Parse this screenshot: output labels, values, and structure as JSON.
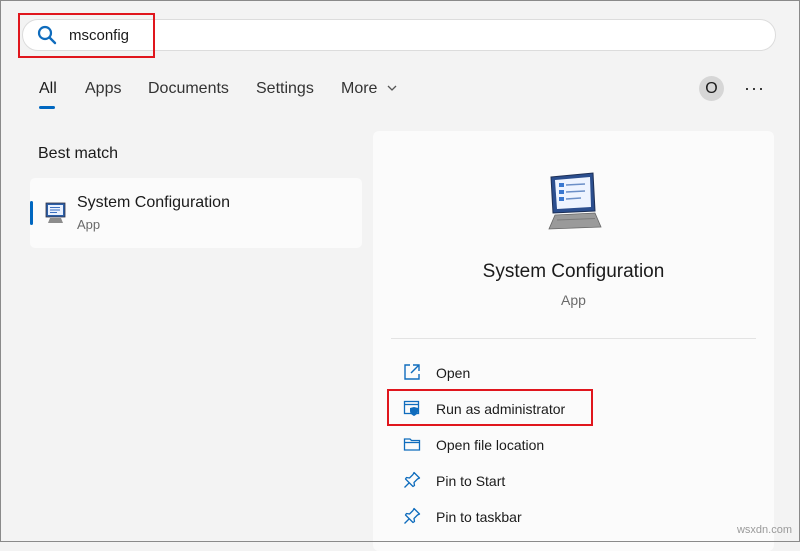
{
  "search": {
    "value": "msconfig",
    "placeholder": ""
  },
  "tabs": [
    {
      "label": "All",
      "active": true
    },
    {
      "label": "Apps"
    },
    {
      "label": "Documents"
    },
    {
      "label": "Settings"
    },
    {
      "label": "More"
    }
  ],
  "header": {
    "avatar_initial": "O",
    "more_options": "···"
  },
  "best_match": {
    "heading": "Best match",
    "title": "System Configuration",
    "subtitle": "App",
    "icon": "system-configuration-icon"
  },
  "detail": {
    "title": "System Configuration",
    "subtitle": "App",
    "icon": "system-configuration-icon",
    "actions": [
      {
        "label": "Open",
        "icon": "open-external-icon"
      },
      {
        "label": "Run as administrator",
        "icon": "shield-admin-icon"
      },
      {
        "label": "Open file location",
        "icon": "folder-icon"
      },
      {
        "label": "Pin to Start",
        "icon": "pin-icon"
      },
      {
        "label": "Pin to taskbar",
        "icon": "pin-icon"
      }
    ]
  },
  "watermark": "wsxdn.com",
  "colors": {
    "accent": "#0067c0",
    "highlight": "#e0161d",
    "background": "#f3f3f3"
  }
}
